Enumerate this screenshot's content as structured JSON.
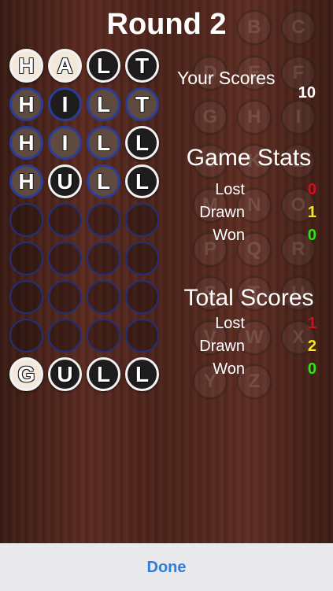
{
  "title": "Round 2",
  "background_letters": [
    "B",
    "C",
    "D",
    "E",
    "F",
    "G",
    "H",
    "I",
    "J",
    "K",
    "L",
    "M",
    "N",
    "O",
    "P",
    "Q",
    "R",
    "S",
    "T",
    "U",
    "V",
    "W",
    "X",
    "Y",
    "Z"
  ],
  "board": {
    "rows": [
      {
        "letters": [
          "H",
          "A",
          "L",
          "T"
        ],
        "styles": [
          "white-beige",
          "white-beige",
          "white",
          "white"
        ]
      },
      {
        "letters": [
          "H",
          "I",
          "L",
          "T"
        ],
        "styles": [
          "blue-brown",
          "blue-dark",
          "blue-brown",
          "blue-brown"
        ]
      },
      {
        "letters": [
          "H",
          "I",
          "L",
          "L"
        ],
        "styles": [
          "blue-brown",
          "blue-brown",
          "blue-brown",
          "white"
        ]
      },
      {
        "letters": [
          "H",
          "U",
          "L",
          "L"
        ],
        "styles": [
          "blue-brown",
          "white",
          "blue-brown",
          "white"
        ]
      },
      {
        "letters": [
          "",
          "",
          "",
          ""
        ],
        "styles": [
          "empty",
          "empty",
          "empty",
          "empty"
        ]
      },
      {
        "letters": [
          "",
          "",
          "",
          ""
        ],
        "styles": [
          "empty",
          "empty",
          "empty",
          "empty"
        ]
      },
      {
        "letters": [
          "",
          "",
          "",
          ""
        ],
        "styles": [
          "empty",
          "empty",
          "empty",
          "empty"
        ]
      },
      {
        "letters": [
          "",
          "",
          "",
          ""
        ],
        "styles": [
          "empty",
          "empty",
          "empty",
          "empty"
        ]
      },
      {
        "letters": [
          "G",
          "U",
          "L",
          "L"
        ],
        "styles": [
          "white-beige",
          "white",
          "white",
          "white"
        ]
      }
    ]
  },
  "your_scores": {
    "label": "Your Scores",
    "value": "10"
  },
  "game_stats": {
    "heading": "Game Stats",
    "lost": {
      "label": "Lost",
      "value": "0"
    },
    "drawn": {
      "label": "Drawn",
      "value": "1"
    },
    "won": {
      "label": "Won",
      "value": "0"
    }
  },
  "total_scores": {
    "heading": "Total Scores",
    "lost": {
      "label": "Lost",
      "value": "1"
    },
    "drawn": {
      "label": "Drawn",
      "value": "2"
    },
    "won": {
      "label": "Won",
      "value": "0"
    }
  },
  "done_label": "Done",
  "colors": {
    "lost": "#d0111b",
    "drawn": "#f7e720",
    "won": "#2fe41a",
    "done": "#2c7ed8",
    "tile_border_blue": "#2b3d9a"
  }
}
